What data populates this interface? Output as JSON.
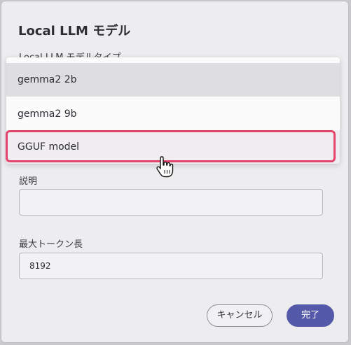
{
  "dialog": {
    "title": "Local LLM モデル",
    "type_label": "Local LLM モデルタイプ",
    "description_label": "説明",
    "description_value": "",
    "max_tokens_label": "最大トークン長",
    "max_tokens_value": "8192",
    "cancel_label": "キャンセル",
    "ok_label": "完了"
  },
  "dropdown": {
    "options": [
      "gemma2 2b",
      "gemma2 9b",
      "GGUF model"
    ],
    "highlighted_index": 2
  },
  "colors": {
    "accent": "#5559a9",
    "highlight_border": "#e3436b"
  },
  "icons": {
    "cursor": "hand-pointer-icon"
  }
}
